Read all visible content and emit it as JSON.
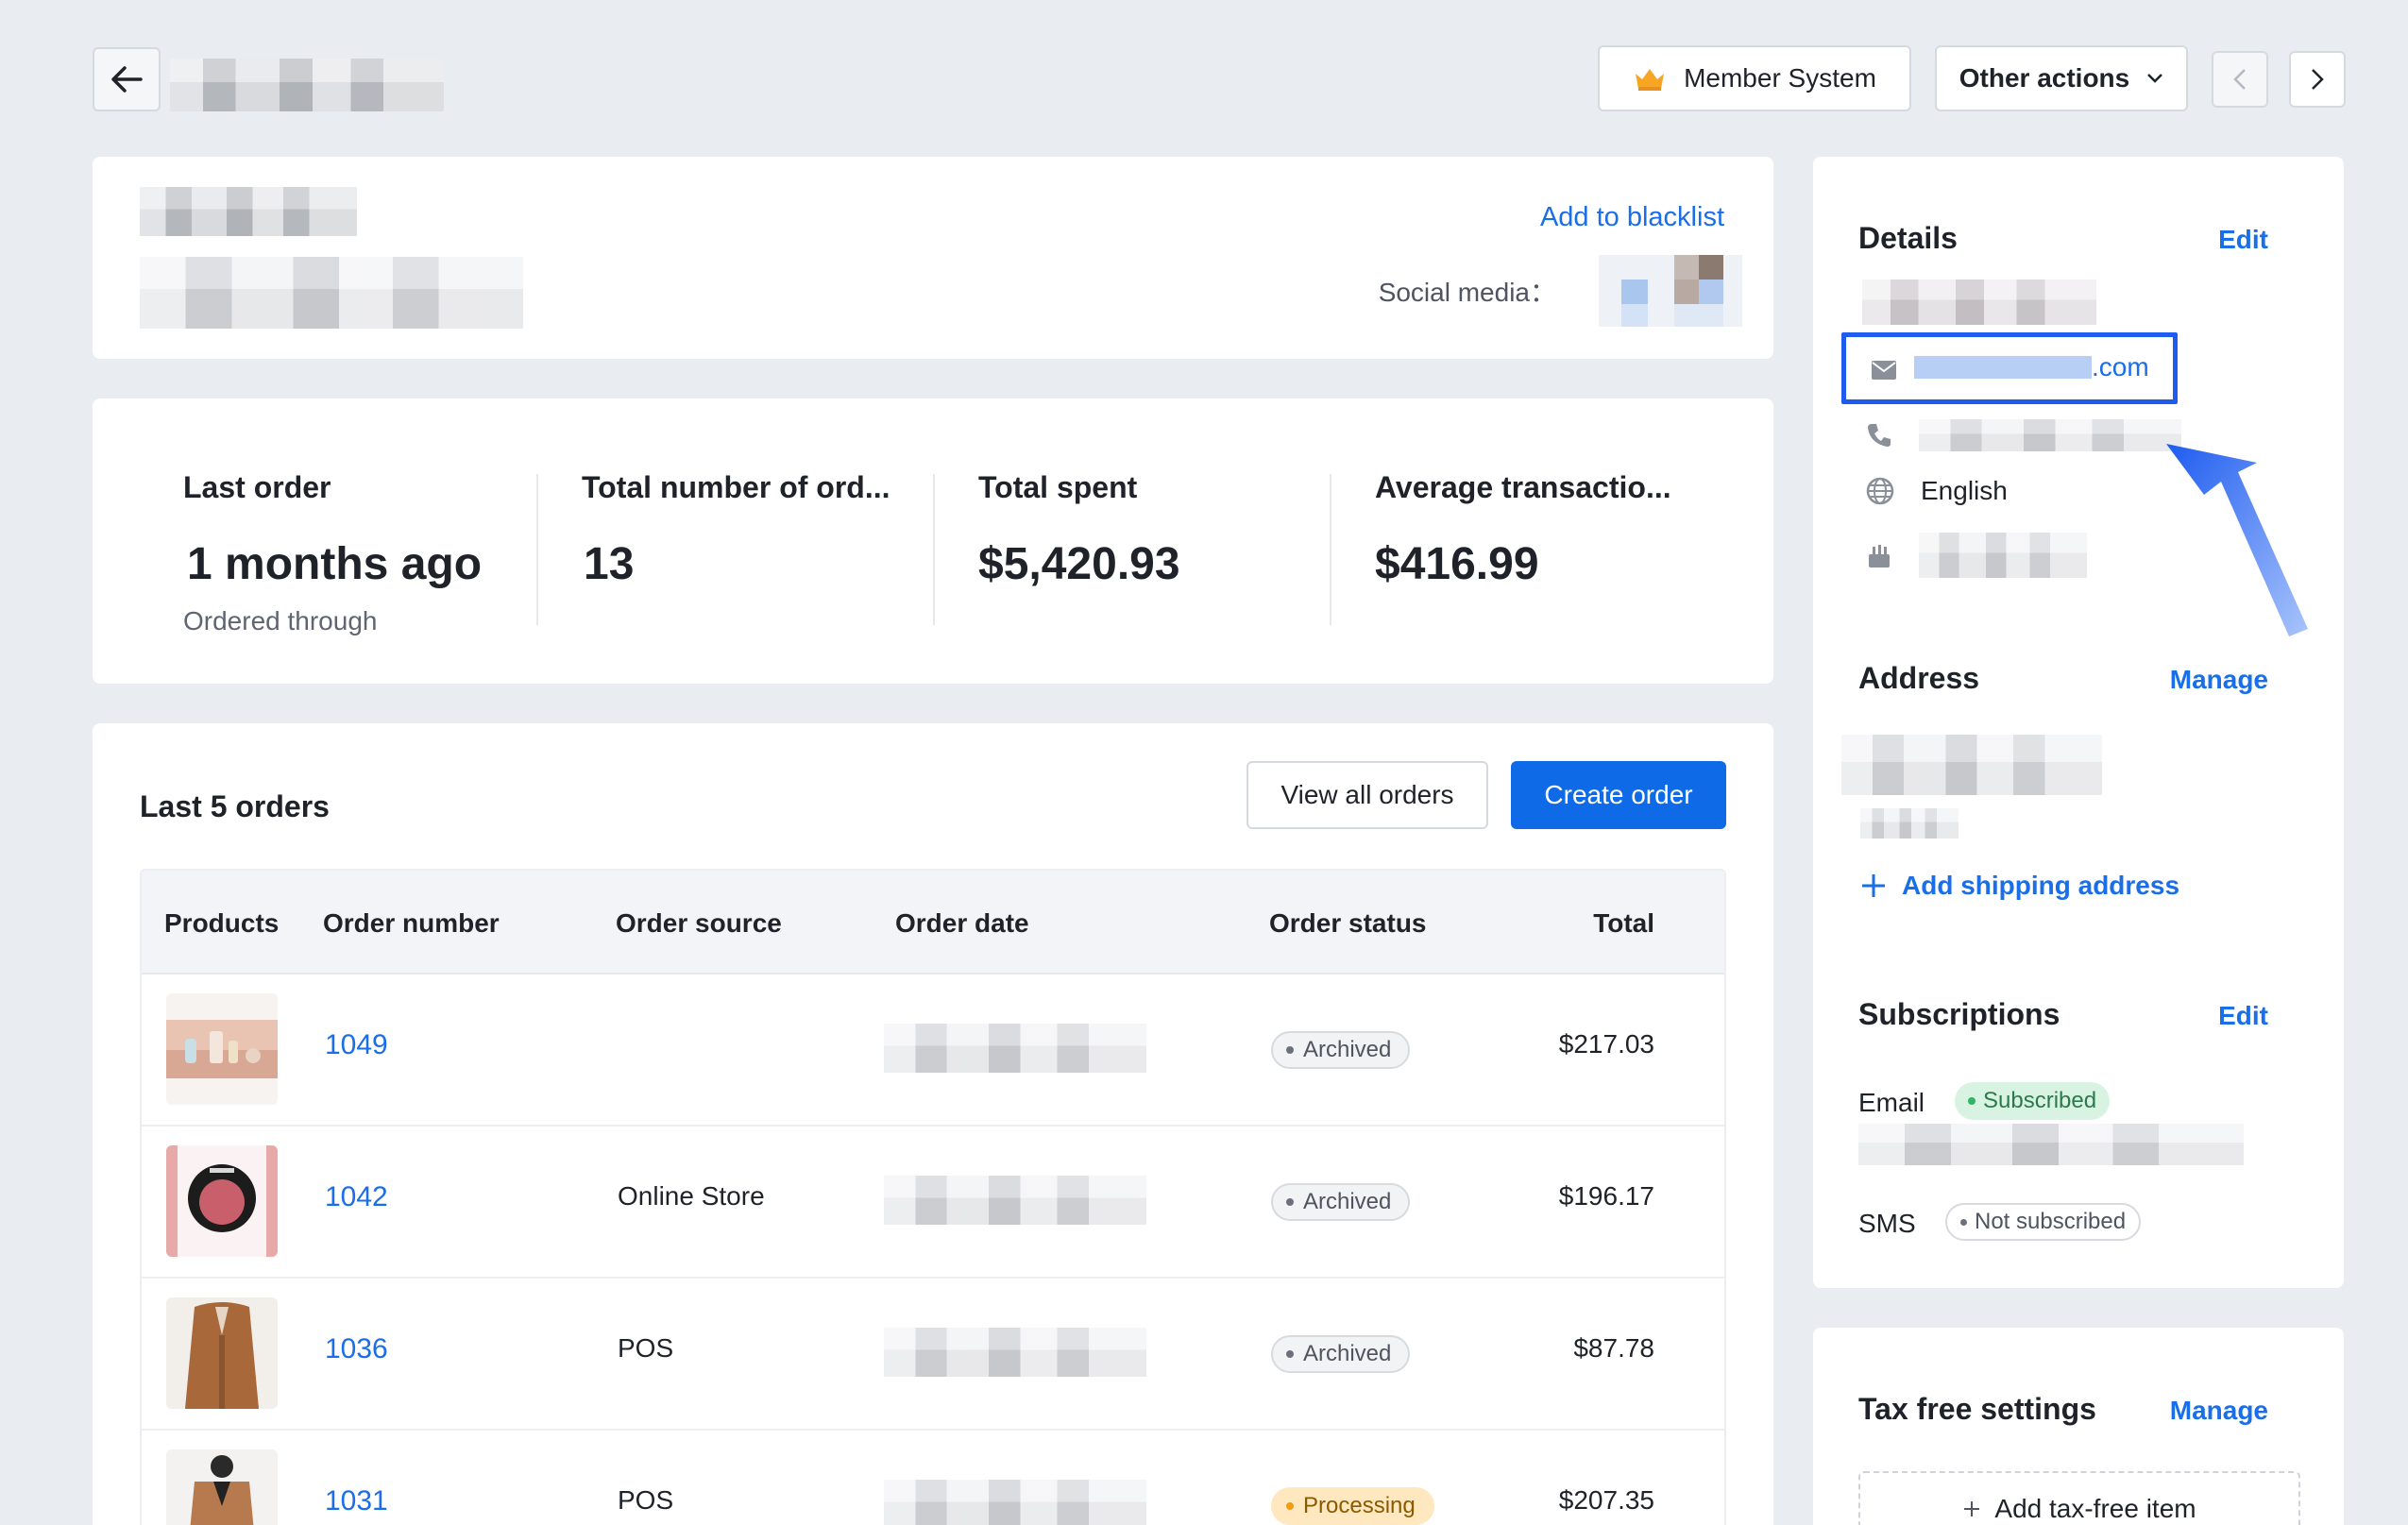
{
  "header": {
    "member_system_label": "Member System",
    "other_actions_label": "Other actions"
  },
  "profile": {
    "blacklist_label": "Add to blacklist",
    "social_label": "Social media："
  },
  "stats": [
    {
      "label": "Last order",
      "value": "1 months ago",
      "sub": "Ordered through"
    },
    {
      "label": "Total number of ord...",
      "value": "13"
    },
    {
      "label": "Total spent",
      "value": "$5,420.93"
    },
    {
      "label": "Average transactio...",
      "value": "$416.99"
    }
  ],
  "orders": {
    "title": "Last 5 orders",
    "view_all_label": "View all orders",
    "create_label": "Create order",
    "columns": [
      "Products",
      "Order number",
      "Order source",
      "Order date",
      "Order status",
      "Total"
    ],
    "rows": [
      {
        "number": "1049",
        "source": "",
        "status": "Archived",
        "total": "$217.03"
      },
      {
        "number": "1042",
        "source": "Online Store",
        "status": "Archived",
        "total": "$196.17"
      },
      {
        "number": "1036",
        "source": "POS",
        "status": "Archived",
        "total": "$87.78"
      },
      {
        "number": "1031",
        "source": "POS",
        "status": "Processing",
        "total": "$207.35"
      }
    ]
  },
  "details": {
    "title": "Details",
    "edit_label": "Edit",
    "email_suffix": ".com",
    "language": "English"
  },
  "address": {
    "title": "Address",
    "manage_label": "Manage",
    "add_shipping_label": "Add shipping address"
  },
  "subscriptions": {
    "title": "Subscriptions",
    "edit_label": "Edit",
    "email_label": "Email",
    "email_status": "Subscribed",
    "sms_label": "SMS",
    "sms_status": "Not subscribed"
  },
  "tax": {
    "title": "Tax free settings",
    "manage_label": "Manage",
    "add_label": "Add tax-free item"
  },
  "colors": {
    "accent": "#1a6ee8",
    "primary_button": "#0f6ae8",
    "highlight_box": "#1e5cf0",
    "background": "#e9ecf1"
  },
  "icons": [
    "back-arrow-icon",
    "crown-icon",
    "chevron-down-icon",
    "chevron-left-icon",
    "chevron-right-icon",
    "mail-icon",
    "phone-icon",
    "globe-icon",
    "cake-icon",
    "plus-icon"
  ]
}
